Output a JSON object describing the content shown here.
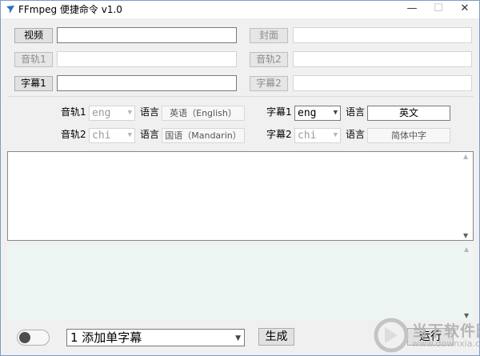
{
  "window": {
    "title": "FFmpeg 便捷命令 v1.0"
  },
  "titlebar": {
    "minimize": "—",
    "maximize": "☐",
    "close": "✕"
  },
  "inputs": {
    "video_label": "视频",
    "cover_label": "封面",
    "audio1_label": "音轨1",
    "audio2_label": "音轨2",
    "sub1_label": "字幕1",
    "sub2_label": "字幕2"
  },
  "tracks": {
    "audio1": {
      "label": "音轨1",
      "code": "eng",
      "lang_label": "语言",
      "lang": "英语（English）"
    },
    "audio2": {
      "label": "音轨2",
      "code": "chi",
      "lang_label": "语言",
      "lang": "国语（Mandarin）"
    },
    "sub1": {
      "label": "字幕1",
      "code": "eng",
      "lang_label": "语言",
      "lang": "英文"
    },
    "sub2": {
      "label": "字幕2",
      "code": "chi",
      "lang_label": "语言",
      "lang": "简体中字"
    }
  },
  "bottom": {
    "mode": "1 添加单字幕",
    "generate": "生成",
    "run": "运行"
  },
  "watermark": {
    "text": "当下软件园",
    "url": "www.downxia.com"
  },
  "colors": {
    "output_bg": "#eef6f4",
    "window_bg": "#f0f0f0",
    "border_accent": "#7a9cc6"
  }
}
